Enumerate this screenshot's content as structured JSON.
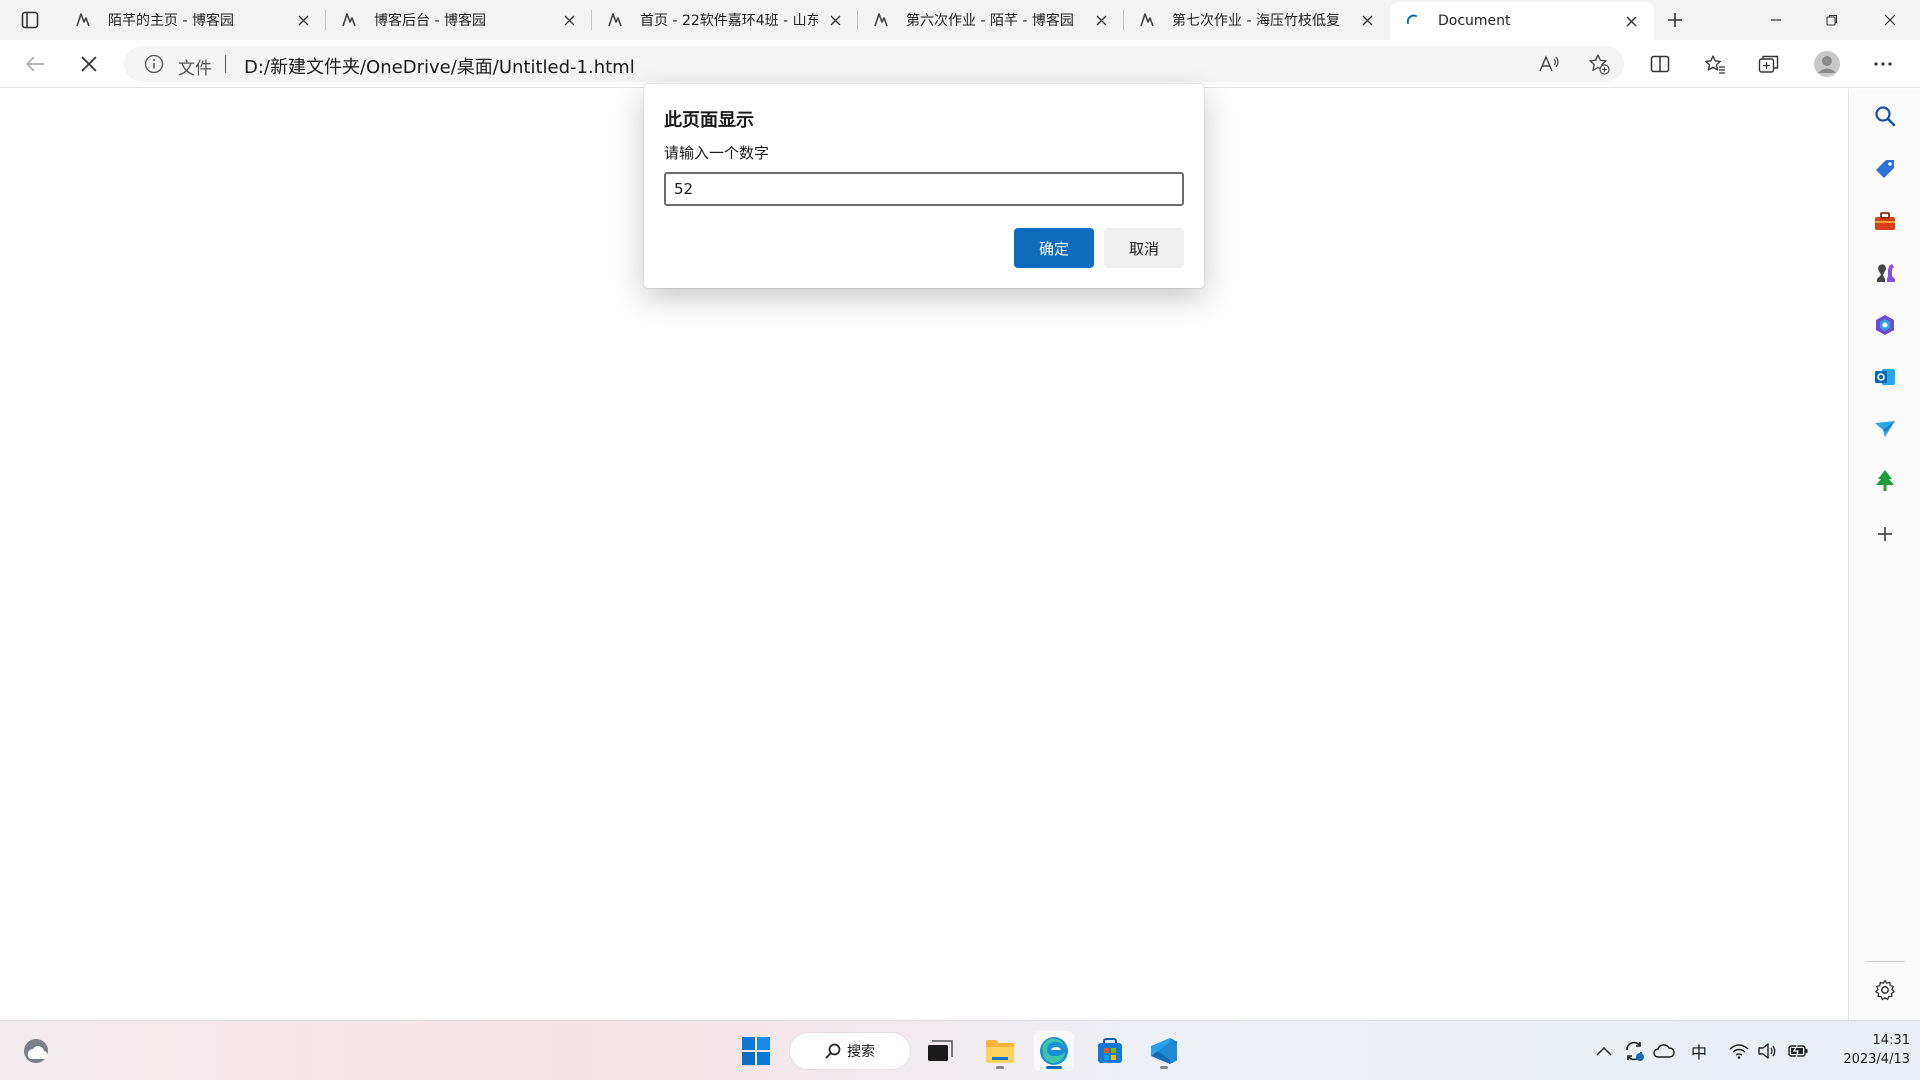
{
  "browser": {
    "tabs": [
      {
        "title": "陌芊的主页 - 博客园"
      },
      {
        "title": "博客后台 - 博客园"
      },
      {
        "title": "首页 - 22软件嘉环4班 - 山东"
      },
      {
        "title": "第六次作业 - 陌芊 - 博客园"
      },
      {
        "title": "第七次作业 - 海压竹枝低复"
      },
      {
        "title": "Document"
      }
    ],
    "address": {
      "info_label": "文件",
      "url": "D:/新建文件夹/OneDrive/桌面/Untitled-1.html"
    }
  },
  "dialog": {
    "title": "此页面显示",
    "message": "请输入一个数字",
    "input_value": "52",
    "ok_label": "确定",
    "cancel_label": "取消"
  },
  "taskbar": {
    "search_label": "搜索",
    "ime_label": "中",
    "time": "14:31",
    "date": "2023/4/13"
  },
  "colors": {
    "accent": "#0f6cbd",
    "tabstrip_bg": "#f3f3f3",
    "omnibox_bg": "#f5f5f5"
  }
}
